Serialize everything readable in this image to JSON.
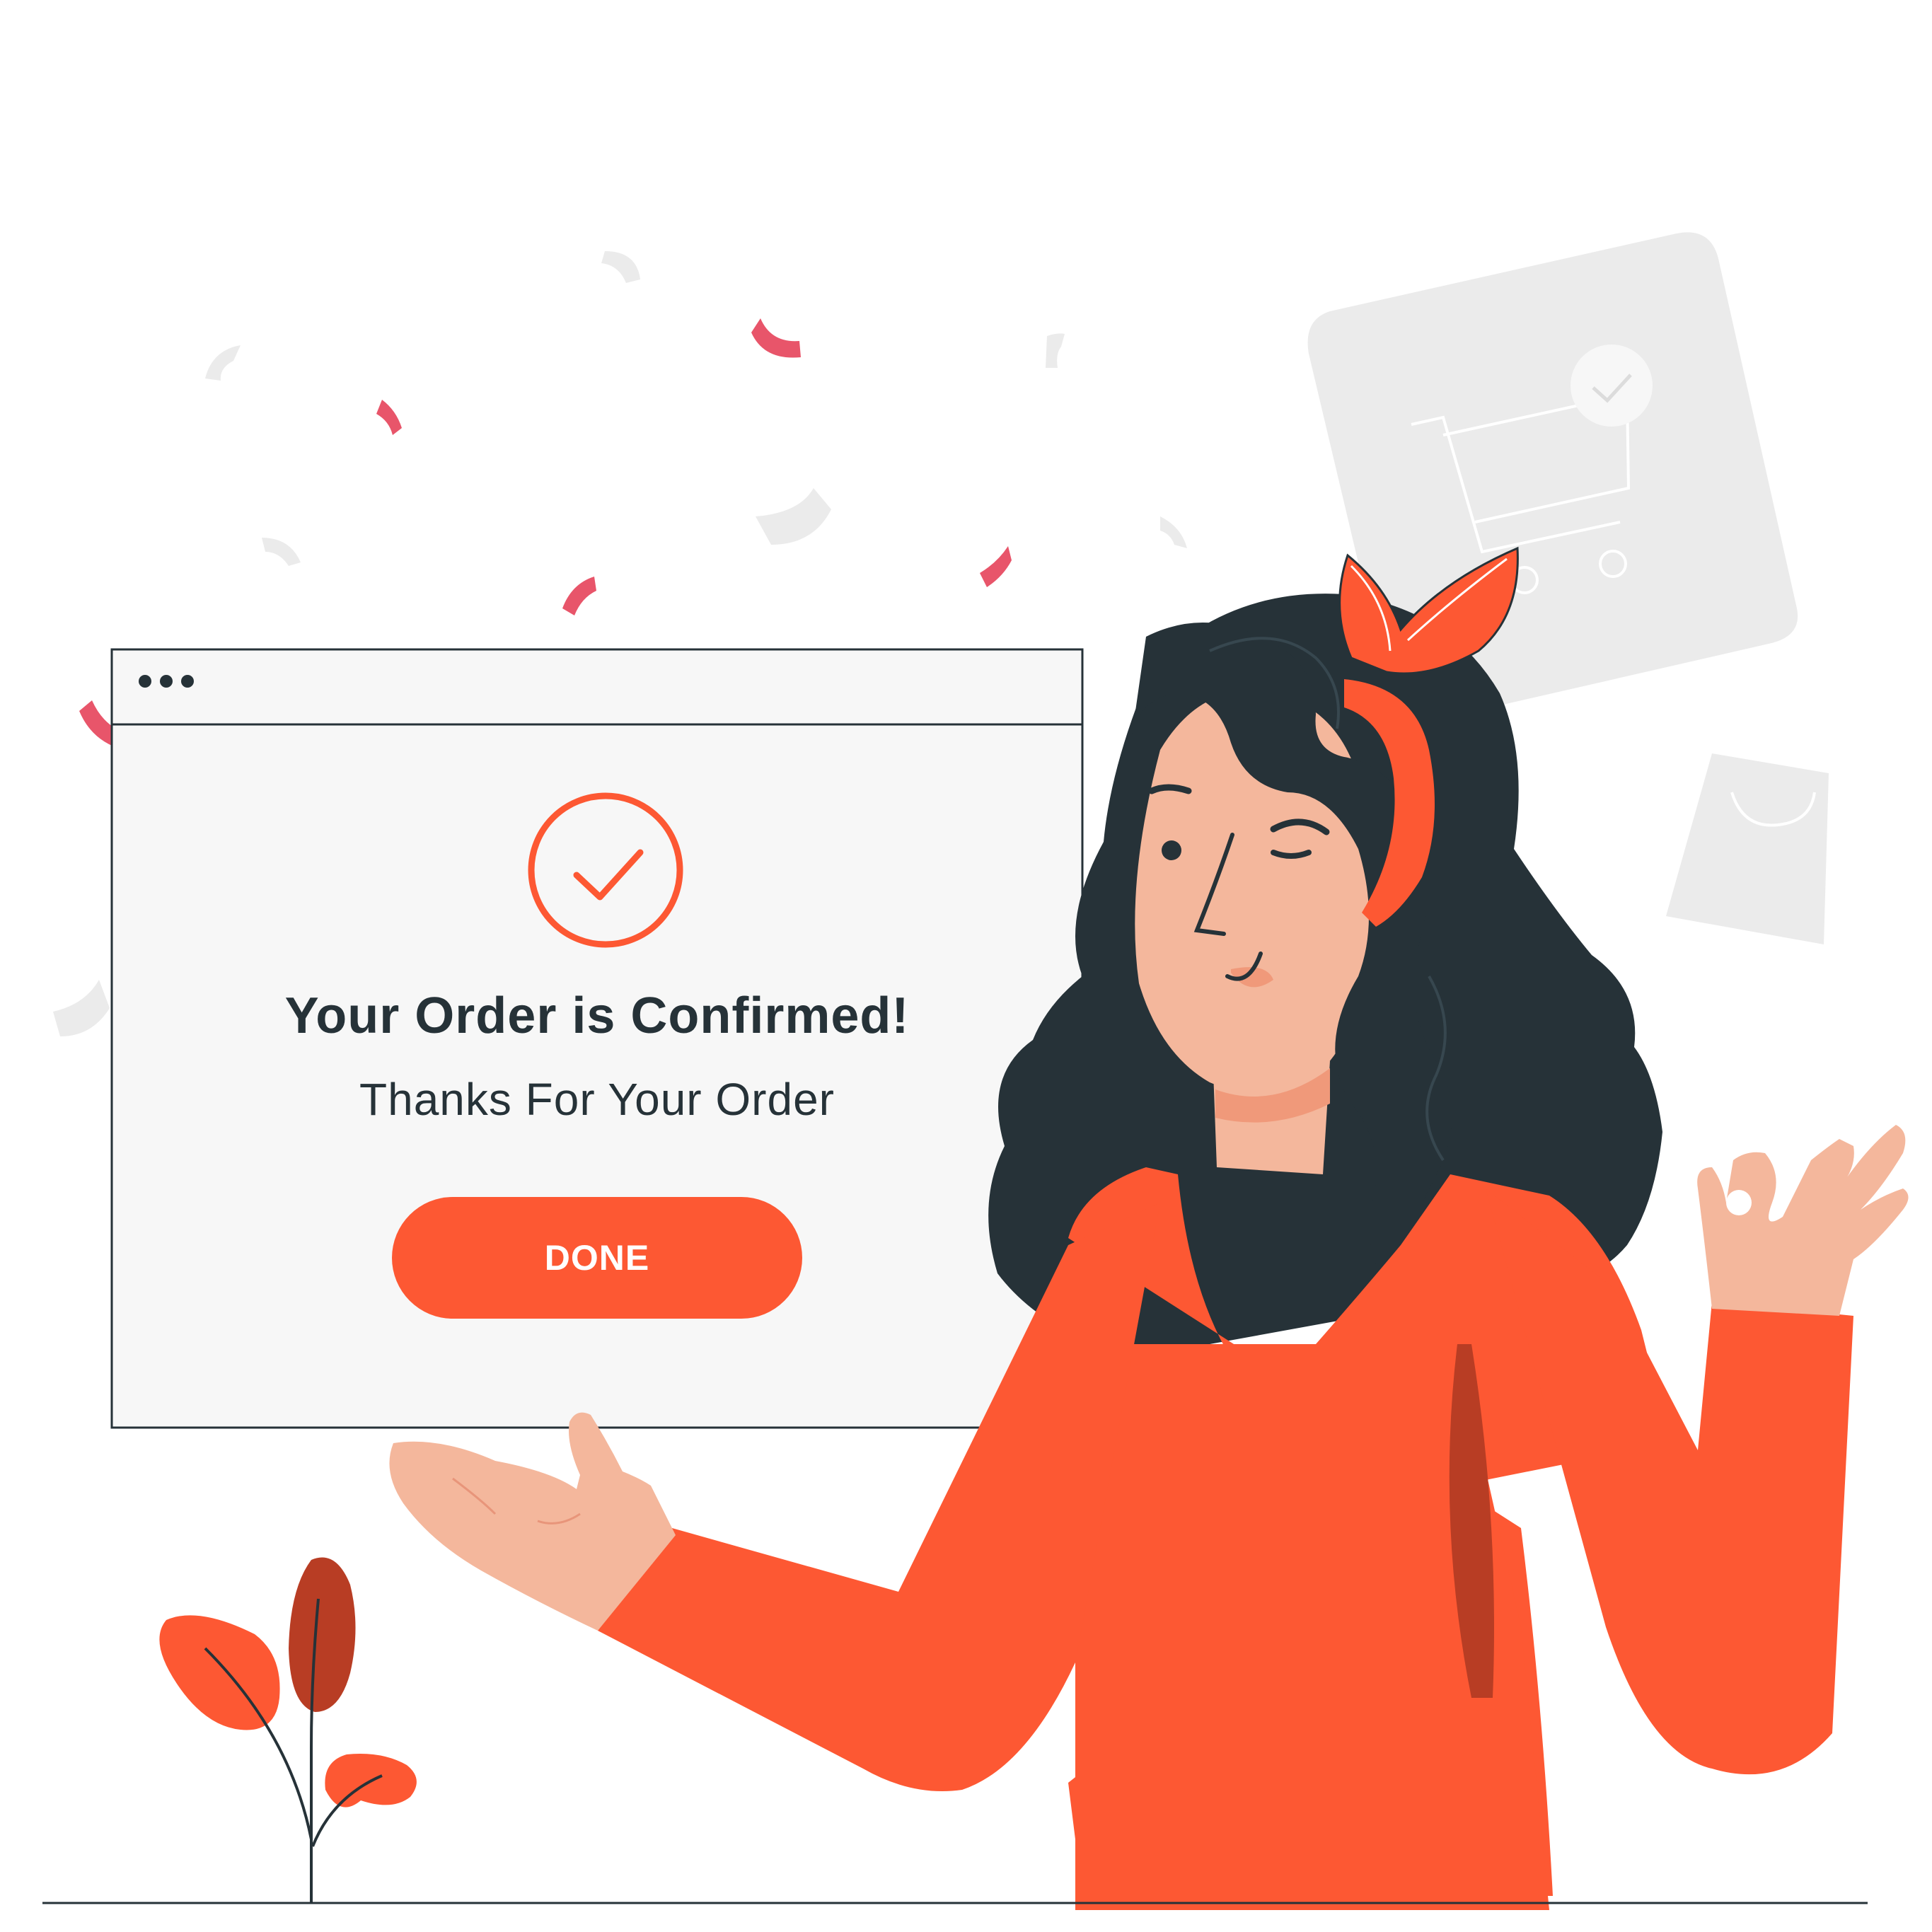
{
  "dialog": {
    "title": "Your Order is Confirmed!",
    "subtitle": "Thanks For Your Order",
    "done_label": "DONE"
  },
  "colors": {
    "accent": "#fd5833",
    "accent_dark": "#b83d24",
    "text": "#263238",
    "window_background": "#f7f7f7",
    "confetti_pink": "#e8556a",
    "background_shapes": "#ebebeb",
    "skin": "#f4b79c"
  },
  "icons": {
    "confirmation": "check-circle-icon",
    "window_controls": "three-dots-icon",
    "cart_card": "shopping-cart-icon",
    "bag": "shopping-bag-icon"
  }
}
